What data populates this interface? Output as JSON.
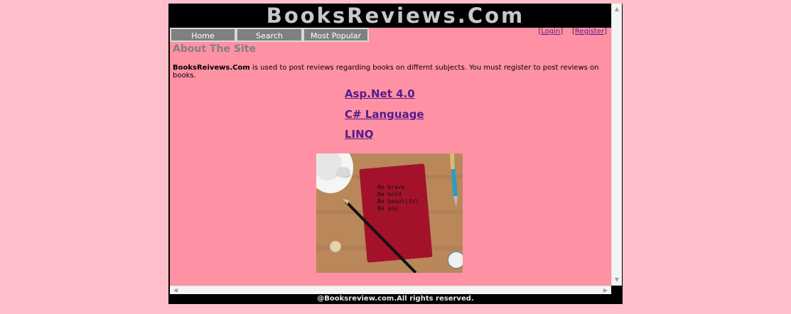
{
  "site": {
    "title": "BooksReviews.Com",
    "footer": "@Booksreview.com.All rights reserved."
  },
  "nav": {
    "items": [
      {
        "label": "Home"
      },
      {
        "label": "Search"
      },
      {
        "label": "Most Popular"
      }
    ]
  },
  "auth": {
    "login": "Login",
    "register": "Register"
  },
  "about": {
    "title": "About The Site",
    "brand": "BooksReivews.Com",
    "text": " is used to post reviews regarding books on differnt subjects. You must register to post reviews on books."
  },
  "books": [
    {
      "label": "Asp.Net 4.0"
    },
    {
      "label": "C# Language"
    },
    {
      "label": "LINQ"
    }
  ],
  "photo": {
    "notebook_text": [
      "Be brave",
      "Be bold",
      "Be beautiful",
      "Be you"
    ]
  },
  "colors": {
    "page_bg": "#ffc0cb",
    "content_bg": "#ff91a4",
    "header_bg": "#000000",
    "nav_bg": "#808080",
    "link": "#551a8b"
  }
}
